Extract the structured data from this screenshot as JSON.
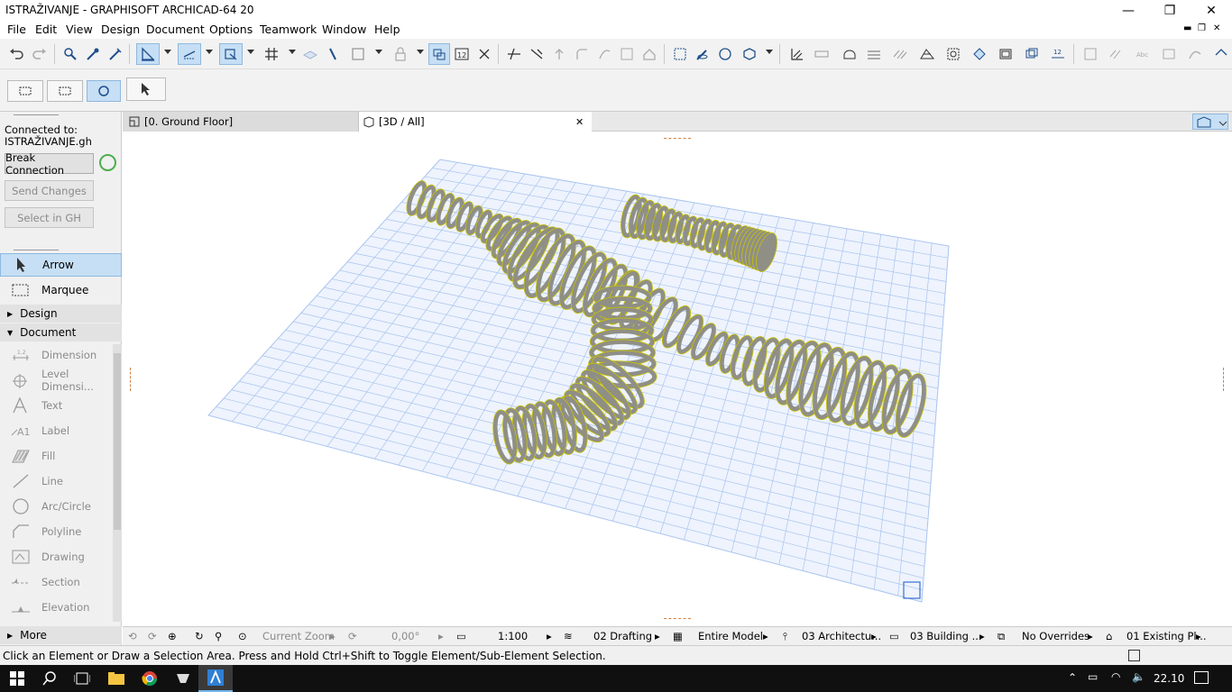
{
  "window": {
    "title": "ISTRAŽIVANJE - GRAPHISOFT ARCHICAD-64 20",
    "minimize": "—",
    "restore": "❐",
    "close": "✕"
  },
  "menu": {
    "items": [
      "File",
      "Edit",
      "View",
      "Design",
      "Document",
      "Options",
      "Teamwork",
      "Window",
      "Help"
    ],
    "mdi_minimize": "▬",
    "mdi_restore": "❐",
    "mdi_close": "✕"
  },
  "left_panel": {
    "connected_label": "Connected to:",
    "connected_file": "ISTRAŽIVANJE.gh",
    "break_button": "Break Connection",
    "send_button": "Send Changes",
    "select_button": "Select in GH",
    "tools_top": [
      "Arrow",
      "Marquee"
    ],
    "design_section": "Design",
    "document_section": "Document",
    "document_tools": [
      "Dimension",
      "Level Dimensi...",
      "Text",
      "Label",
      "Fill",
      "Line",
      "Arc/Circle",
      "Polyline",
      "Drawing",
      "Section",
      "Elevation"
    ],
    "more_section": "More"
  },
  "tabs": {
    "floor_plan": "[0. Ground Floor]",
    "view_3d": "[3D / All]",
    "close": "✕"
  },
  "navbar": {
    "zoom": "Current Zoom",
    "angle": "0,00°",
    "scale": "1:100",
    "layer_combo": "02 Drafting",
    "model_view": "Entire Model",
    "pen_set": "03 Architectu...",
    "mvo": "03 Building ...",
    "overrides": "No Overrides",
    "renovation": "01 Existing Pl..."
  },
  "status": {
    "message": "Click an Element or Draw a Selection Area. Press and Hold Ctrl+Shift to Toggle Element/Sub-Element Selection."
  },
  "taskbar": {
    "time": "22.10"
  },
  "colors": {
    "accent": "#c6dff5",
    "grid_fill": "#eef3fd",
    "grid_line": "#a9c4ef",
    "stripe_fill": "#8f8f86",
    "stripe_edge": "#c8c200"
  }
}
